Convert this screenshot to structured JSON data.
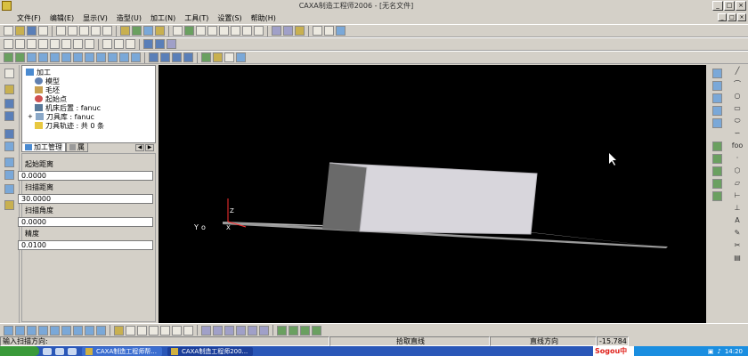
{
  "window": {
    "title": "CAXA制造工程师2006 - [无名文件]"
  },
  "menubar": {
    "items": [
      "文件(F)",
      "编辑(E)",
      "显示(V)",
      "造型(U)",
      "加工(N)",
      "工具(T)",
      "设置(S)",
      "帮助(H)"
    ]
  },
  "tree": {
    "root": "加工",
    "items": [
      "模型",
      "毛坯",
      "起始点",
      "机床后置 : fanuc",
      "刀具库 : fanuc",
      "刀具轨迹 : 共 0 条"
    ]
  },
  "tabs": {
    "active": "加工管理",
    "inactive": "属"
  },
  "properties": {
    "fields": [
      {
        "label": "起始距离",
        "value": "0.0000"
      },
      {
        "label": "扫描距离",
        "value": "30.0000"
      },
      {
        "label": "扫描角度",
        "value": "0.0000"
      },
      {
        "label": "精度",
        "value": "0.0100"
      }
    ]
  },
  "viewport": {
    "axis_z": "Z",
    "axis_y": "Y",
    "axis_o": "o",
    "axis_x": "X"
  },
  "right_labels": {
    "foo": "foo"
  },
  "status": {
    "prompt": "输入扫描方向:",
    "center": "拾取直线",
    "mode": "直线方向",
    "coord": "-15.784"
  },
  "taskbar": {
    "tasks": [
      "CAXA制造工程师帮...",
      "CAXA制造工程师200..."
    ],
    "sogou": "Sogou中",
    "clock": "14:20"
  },
  "colors": {
    "viewport_bg": "#000000",
    "panel_bg": "#d4d0c8",
    "taskbar": "#2a57b8"
  }
}
